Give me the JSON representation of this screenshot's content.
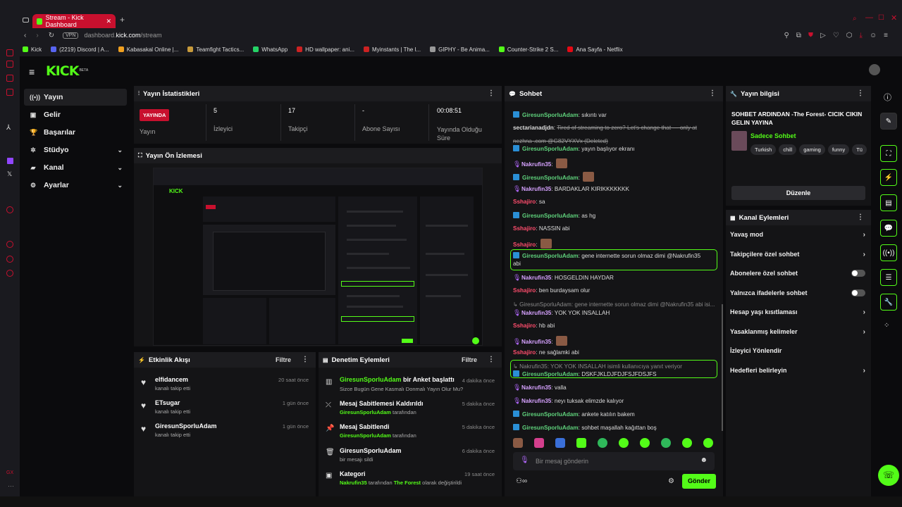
{
  "browser": {
    "tab_title": "Stream - Kick Dashboard",
    "url_prefix": "dashboard.",
    "url_host": "kick.com",
    "url_path": "/stream",
    "vpn": "VPN",
    "bookmarks": [
      {
        "label": "Kick",
        "color": "#53fc18"
      },
      {
        "label": "(2219) Discord | A...",
        "color": "#5865f2"
      },
      {
        "label": "Kabasakal Online |...",
        "color": "#f0a020"
      },
      {
        "label": "Teamfight Tactics...",
        "color": "#c89b3c"
      },
      {
        "label": "WhatsApp",
        "color": "#25d366"
      },
      {
        "label": "HD wallpaper: ani...",
        "color": "#cc2222"
      },
      {
        "label": "Myinstants | The l...",
        "color": "#cc2222"
      },
      {
        "label": "GIPHY - Be Anima...",
        "color": "#999999"
      },
      {
        "label": "Counter-Strike 2 S...",
        "color": "#53fc18"
      },
      {
        "label": "Ana Sayfa - Netflix",
        "color": "#e50914"
      }
    ]
  },
  "logo": "KICK",
  "logo_beta": "BETA",
  "nav": [
    {
      "label": "Yayın",
      "icon": "((•))",
      "chev": ""
    },
    {
      "label": "Gelir",
      "icon": "▣",
      "chev": ""
    },
    {
      "label": "Başarılar",
      "icon": "🏆",
      "chev": ""
    },
    {
      "label": "Stüdyo",
      "icon": "✲",
      "chev": "⌄"
    },
    {
      "label": "Kanal",
      "icon": "▰",
      "chev": "⌄"
    },
    {
      "label": "Ayarlar",
      "icon": "⚙",
      "chev": "⌄"
    }
  ],
  "stats": {
    "title": "Yayın İstatistikleri",
    "live_badge": "YAYINDA",
    "live_label": "Yayın",
    "items": [
      {
        "value": "5",
        "label": "İzleyici"
      },
      {
        "value": "17",
        "label": "Takipçi"
      },
      {
        "value": "-",
        "label": "Abone Sayısı"
      },
      {
        "value": "00:08:51",
        "label": "Yayında Olduğu Süre"
      }
    ]
  },
  "preview": {
    "title": "Yayın Ön İzlemesi"
  },
  "activity": {
    "title": "Etkinlik Akışı",
    "filter": "Filtre",
    "items": [
      {
        "user": "elfidancem",
        "action": "kanalı takip etti",
        "time": "20 saat önce"
      },
      {
        "user": "ETsugar",
        "action": "kanalı takip etti",
        "time": "1 gün önce"
      },
      {
        "user": "GiresunSporluAdam",
        "action": "kanalı takip etti",
        "time": "1 gün önce"
      }
    ]
  },
  "moderation": {
    "title": "Denetim Eylemleri",
    "filter": "Filtre",
    "items": [
      {
        "title_user": "GiresunSporluAdam",
        "title_rest": " bir Anket başlattı",
        "sub": "Sizce Bugün Gene Kasmalı Donmalı Yayın Olur Mu?",
        "time": "4 dakika önce"
      },
      {
        "title": "Mesaj Sabitlemesi Kaldırıldı",
        "sub_user": "GiresunSporluAdam",
        "sub_rest": " tarafından",
        "time": "5 dakika önce"
      },
      {
        "title": "Mesaj Sabitlendi",
        "sub_user": "GiresunSporluAdam",
        "sub_rest": " tarafından",
        "time": "5 dakika önce"
      },
      {
        "title": "GiresunSporluAdam",
        "sub": "bir mesajı sildi",
        "time": "6 dakika önce"
      },
      {
        "title": "Kategori",
        "sub_user": "Nakrufin35",
        "sub_mid": " tarafından ",
        "sub_user2": "The Forest",
        "sub_rest": " olarak değiştirildi",
        "time": "19 saat önce"
      }
    ]
  },
  "chat": {
    "title": "Sohbet",
    "placeholder": "Bir mesaj gönderin",
    "send": "Gönder",
    "messages": [
      {
        "user": "GiresunSporluAdam",
        "text": "sıkıntı var"
      },
      {
        "user": "sectarianadjdn",
        "text": "Tired of streaming to zero? Let's change that — only at"
      },
      {
        "user": "",
        "text": "nezhna .com @G82VYXVx (Deleted)"
      },
      {
        "user": "GiresunSporluAdam",
        "text": "yayın başlıyor ekranı"
      },
      {
        "user": "Nakrufin35",
        "text": ""
      },
      {
        "user": "GiresunSporluAdam",
        "text": ""
      },
      {
        "user": "Nakrufin35",
        "text": "BARDAKLAR KIRIKKKKKKK"
      },
      {
        "user": "Sshajiro",
        "text": "sa"
      },
      {
        "user": "GiresunSporluAdam",
        "text": "as hg"
      },
      {
        "user": "Sshajiro",
        "text": "NASSIN abi"
      },
      {
        "user": "Sshajiro",
        "text": ""
      },
      {
        "user": "GiresunSporluAdam",
        "text": "gene internette sorun olmaz dimi @Nakrufin35"
      },
      {
        "user": "",
        "text": "abi"
      },
      {
        "user": "Nakrufin35",
        "text": "HOSGELDIN HAYDAR"
      },
      {
        "user": "Sshajiro",
        "text": "ben burdaysam olur"
      },
      {
        "user": "",
        "text": "↳ GiresunSporluAdam: gene internette sorun olmaz dimi @Nakrufin35 abi isi..."
      },
      {
        "user": "Nakrufin35",
        "text": "YOK YOK INSALLAH"
      },
      {
        "user": "Sshajiro",
        "text": "hb abi"
      },
      {
        "user": "Nakrufin35",
        "text": ""
      },
      {
        "user": "Sshajiro",
        "text": "ne sağlamki abi"
      },
      {
        "user": "",
        "text": "↳ Nakrufin35: YOK YOK INSALLAH isimli kullanıcıya yanıt veriyor"
      },
      {
        "user": "GiresunSporluAdam",
        "text": "DSKFJKLDJFDJFSJFDSJFS"
      },
      {
        "user": "Nakrufin35",
        "text": "valla"
      },
      {
        "user": "Nakrufin35",
        "text": "neyı tuksak elimzde kalıyor"
      },
      {
        "user": "GiresunSporluAdam",
        "text": "ankete katılın bakem"
      },
      {
        "user": "GiresunSporluAdam",
        "text": "sohbet maşallah kağıttan boş"
      }
    ]
  },
  "stream_info": {
    "title": "Yayın bilgisi",
    "stream_title": "SOHBET ARDINDAN -The Forest- CICIK CIKIN GELIN YAYINA",
    "category": "Sadece Sohbet",
    "tags": [
      "Turkish",
      "chill",
      "gaming",
      "funny",
      "Tü"
    ],
    "edit": "Düzenle"
  },
  "channel_actions": {
    "title": "Kanal Eylemleri",
    "items": [
      {
        "label": "Yavaş mod",
        "kind": "chev"
      },
      {
        "label": "Takipçilere özel sohbet",
        "kind": "chev"
      },
      {
        "label": "Abonelere özel sohbet",
        "kind": "toggle"
      },
      {
        "label": "Yalnızca ifadelerle sohbet",
        "kind": "toggle"
      },
      {
        "label": "Hesap yaşı kısıtlaması",
        "kind": "chev"
      },
      {
        "label": "Yasaklanmış kelimeler",
        "kind": "chev"
      },
      {
        "label": "İzleyici Yönlendir",
        "kind": "none"
      },
      {
        "label": "Hedefleri belirleyin",
        "kind": "chev"
      }
    ]
  },
  "colors": {
    "brand": "#53fc18",
    "live": "#c8102e",
    "opera": "#c8102e"
  }
}
